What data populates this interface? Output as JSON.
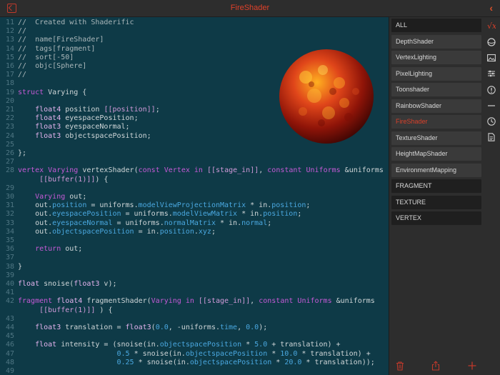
{
  "app": {
    "title": "FireShader"
  },
  "editor": {
    "lines": [
      {
        "n": "11",
        "html": "<span class=\"cm\">//  Created with Shaderific</span>"
      },
      {
        "n": "12",
        "html": "<span class=\"cm\">//</span>"
      },
      {
        "n": "13",
        "html": "<span class=\"cm\">//  name[FireShader]</span>"
      },
      {
        "n": "14",
        "html": "<span class=\"cm\">//  tags[fragment]</span>"
      },
      {
        "n": "15",
        "html": "<span class=\"cm\">//  sort[-50]</span>"
      },
      {
        "n": "16",
        "html": "<span class=\"cm\">//  objc[Sphere]</span>"
      },
      {
        "n": "17",
        "html": "<span class=\"cm\">//</span>"
      },
      {
        "n": "18",
        "html": ""
      },
      {
        "n": "19",
        "html": "<span class=\"kw\">struct</span> Varying {"
      },
      {
        "n": "20",
        "html": ""
      },
      {
        "n": "21",
        "html": "    <span class=\"ty\">float4</span> position <span class=\"at\">[[position]]</span>;"
      },
      {
        "n": "22",
        "html": "    <span class=\"ty\">float4</span> eyespacePosition;"
      },
      {
        "n": "23",
        "html": "    <span class=\"ty\">float3</span> eyespaceNormal;"
      },
      {
        "n": "24",
        "html": "    <span class=\"ty\">float3</span> objectspacePosition;"
      },
      {
        "n": "25",
        "html": ""
      },
      {
        "n": "26",
        "html": "};"
      },
      {
        "n": "27",
        "html": ""
      },
      {
        "n": "28",
        "html": "<span class=\"kw\">vertex</span> <span class=\"kw\">Varying</span> vertexShader(<span class=\"kw\">const</span> <span class=\"kw\">Vertex</span> <span class=\"kw\">in</span> <span class=\"at\">[[stage_in]]</span>, <span class=\"kw\">constant</span> <span class=\"kw\">Uniforms</span> &uniforms"
      },
      {
        "n": "",
        "html": "     <span class=\"at\">[[buffer(1)]]</span>) {"
      },
      {
        "n": "29",
        "html": ""
      },
      {
        "n": "30",
        "html": "    <span class=\"kw\">Varying</span> out;"
      },
      {
        "n": "31",
        "html": "    out.<span class=\"nm\">position</span> = uniforms.<span class=\"nm\">modelViewProjectionMatrix</span> * in.<span class=\"nm\">position</span>;"
      },
      {
        "n": "32",
        "html": "    out.<span class=\"nm\">eyespacePosition</span> = uniforms.<span class=\"nm\">modelViewMatrix</span> * in.<span class=\"nm\">position</span>;"
      },
      {
        "n": "33",
        "html": "    out.<span class=\"nm\">eyespaceNormal</span> = uniforms.<span class=\"nm\">normalMatrix</span> * in.<span class=\"nm\">normal</span>;"
      },
      {
        "n": "34",
        "html": "    out.<span class=\"nm\">objectspacePosition</span> = in.<span class=\"nm\">position</span>.<span class=\"nm\">xyz</span>;"
      },
      {
        "n": "35",
        "html": ""
      },
      {
        "n": "36",
        "html": "    <span class=\"kw\">return</span> out;"
      },
      {
        "n": "37",
        "html": ""
      },
      {
        "n": "38",
        "html": "}"
      },
      {
        "n": "39",
        "html": ""
      },
      {
        "n": "40",
        "html": "<span class=\"ty\">float</span> snoise(<span class=\"ty\">float3</span> v);"
      },
      {
        "n": "41",
        "html": ""
      },
      {
        "n": "42",
        "html": "<span class=\"kw\">fragment</span> <span class=\"ty\">float4</span> fragmentShader(<span class=\"kw\">Varying</span> <span class=\"kw\">in</span> <span class=\"at\">[[stage_in]]</span>, <span class=\"kw\">constant</span> <span class=\"kw\">Uniforms</span> &uniforms"
      },
      {
        "n": "",
        "html": "     <span class=\"at\">[[buffer(1)]]</span> ) {"
      },
      {
        "n": "43",
        "html": ""
      },
      {
        "n": "44",
        "html": "    <span class=\"ty\">float3</span> translation = <span class=\"ty\">float3</span>(<span class=\"nm\">0.0</span>, -uniforms.<span class=\"nm\">time</span>, <span class=\"nm\">0.0</span>);"
      },
      {
        "n": "45",
        "html": ""
      },
      {
        "n": "46",
        "html": "    <span class=\"ty\">float</span> intensity = (snoise(in.<span class=\"nm\">objectspacePosition</span> * <span class=\"nm\">5.0</span> + translation) +"
      },
      {
        "n": "47",
        "html": "                       <span class=\"nm\">0.5</span> * snoise(in.<span class=\"nm\">objectspacePosition</span> * <span class=\"nm\">10.0</span> * translation) +"
      },
      {
        "n": "48",
        "html": "                       <span class=\"nm\">0.25</span> * snoise(in.<span class=\"nm\">objectspacePosition</span> * <span class=\"nm\">20.0</span> * translation));"
      },
      {
        "n": "49",
        "html": ""
      }
    ]
  },
  "sidebar": {
    "items": [
      {
        "label": "ALL",
        "kind": "all"
      },
      {
        "label": "DepthShader",
        "kind": "shader"
      },
      {
        "label": "VertexLighting",
        "kind": "shader"
      },
      {
        "label": "PixelLighting",
        "kind": "shader"
      },
      {
        "label": "Toonshader",
        "kind": "shader"
      },
      {
        "label": "RainbowShader",
        "kind": "shader"
      },
      {
        "label": "FireShader",
        "kind": "selected"
      },
      {
        "label": "TextureShader",
        "kind": "shader"
      },
      {
        "label": "HeightMapShader",
        "kind": "shader"
      },
      {
        "label": "EnvironmentMapping",
        "kind": "shader"
      },
      {
        "label": "FRAGMENT",
        "kind": "category"
      },
      {
        "label": "TEXTURE",
        "kind": "category"
      },
      {
        "label": "VERTEX",
        "kind": "category"
      }
    ]
  },
  "icons": {
    "top_left": "window-icon",
    "top_right": "chevron-left-icon",
    "rail": [
      "function-icon",
      "sphere-icon",
      "image-icon",
      "sliders-icon",
      "warning-icon",
      "minus-icon",
      "clock-icon",
      "document-icon"
    ],
    "bottom": [
      "trash-icon",
      "share-icon",
      "add-icon"
    ]
  },
  "colors": {
    "accent": "#d9402a",
    "editor_bg": "#0e3a47",
    "sidebar_bg": "#2d2d2d"
  }
}
